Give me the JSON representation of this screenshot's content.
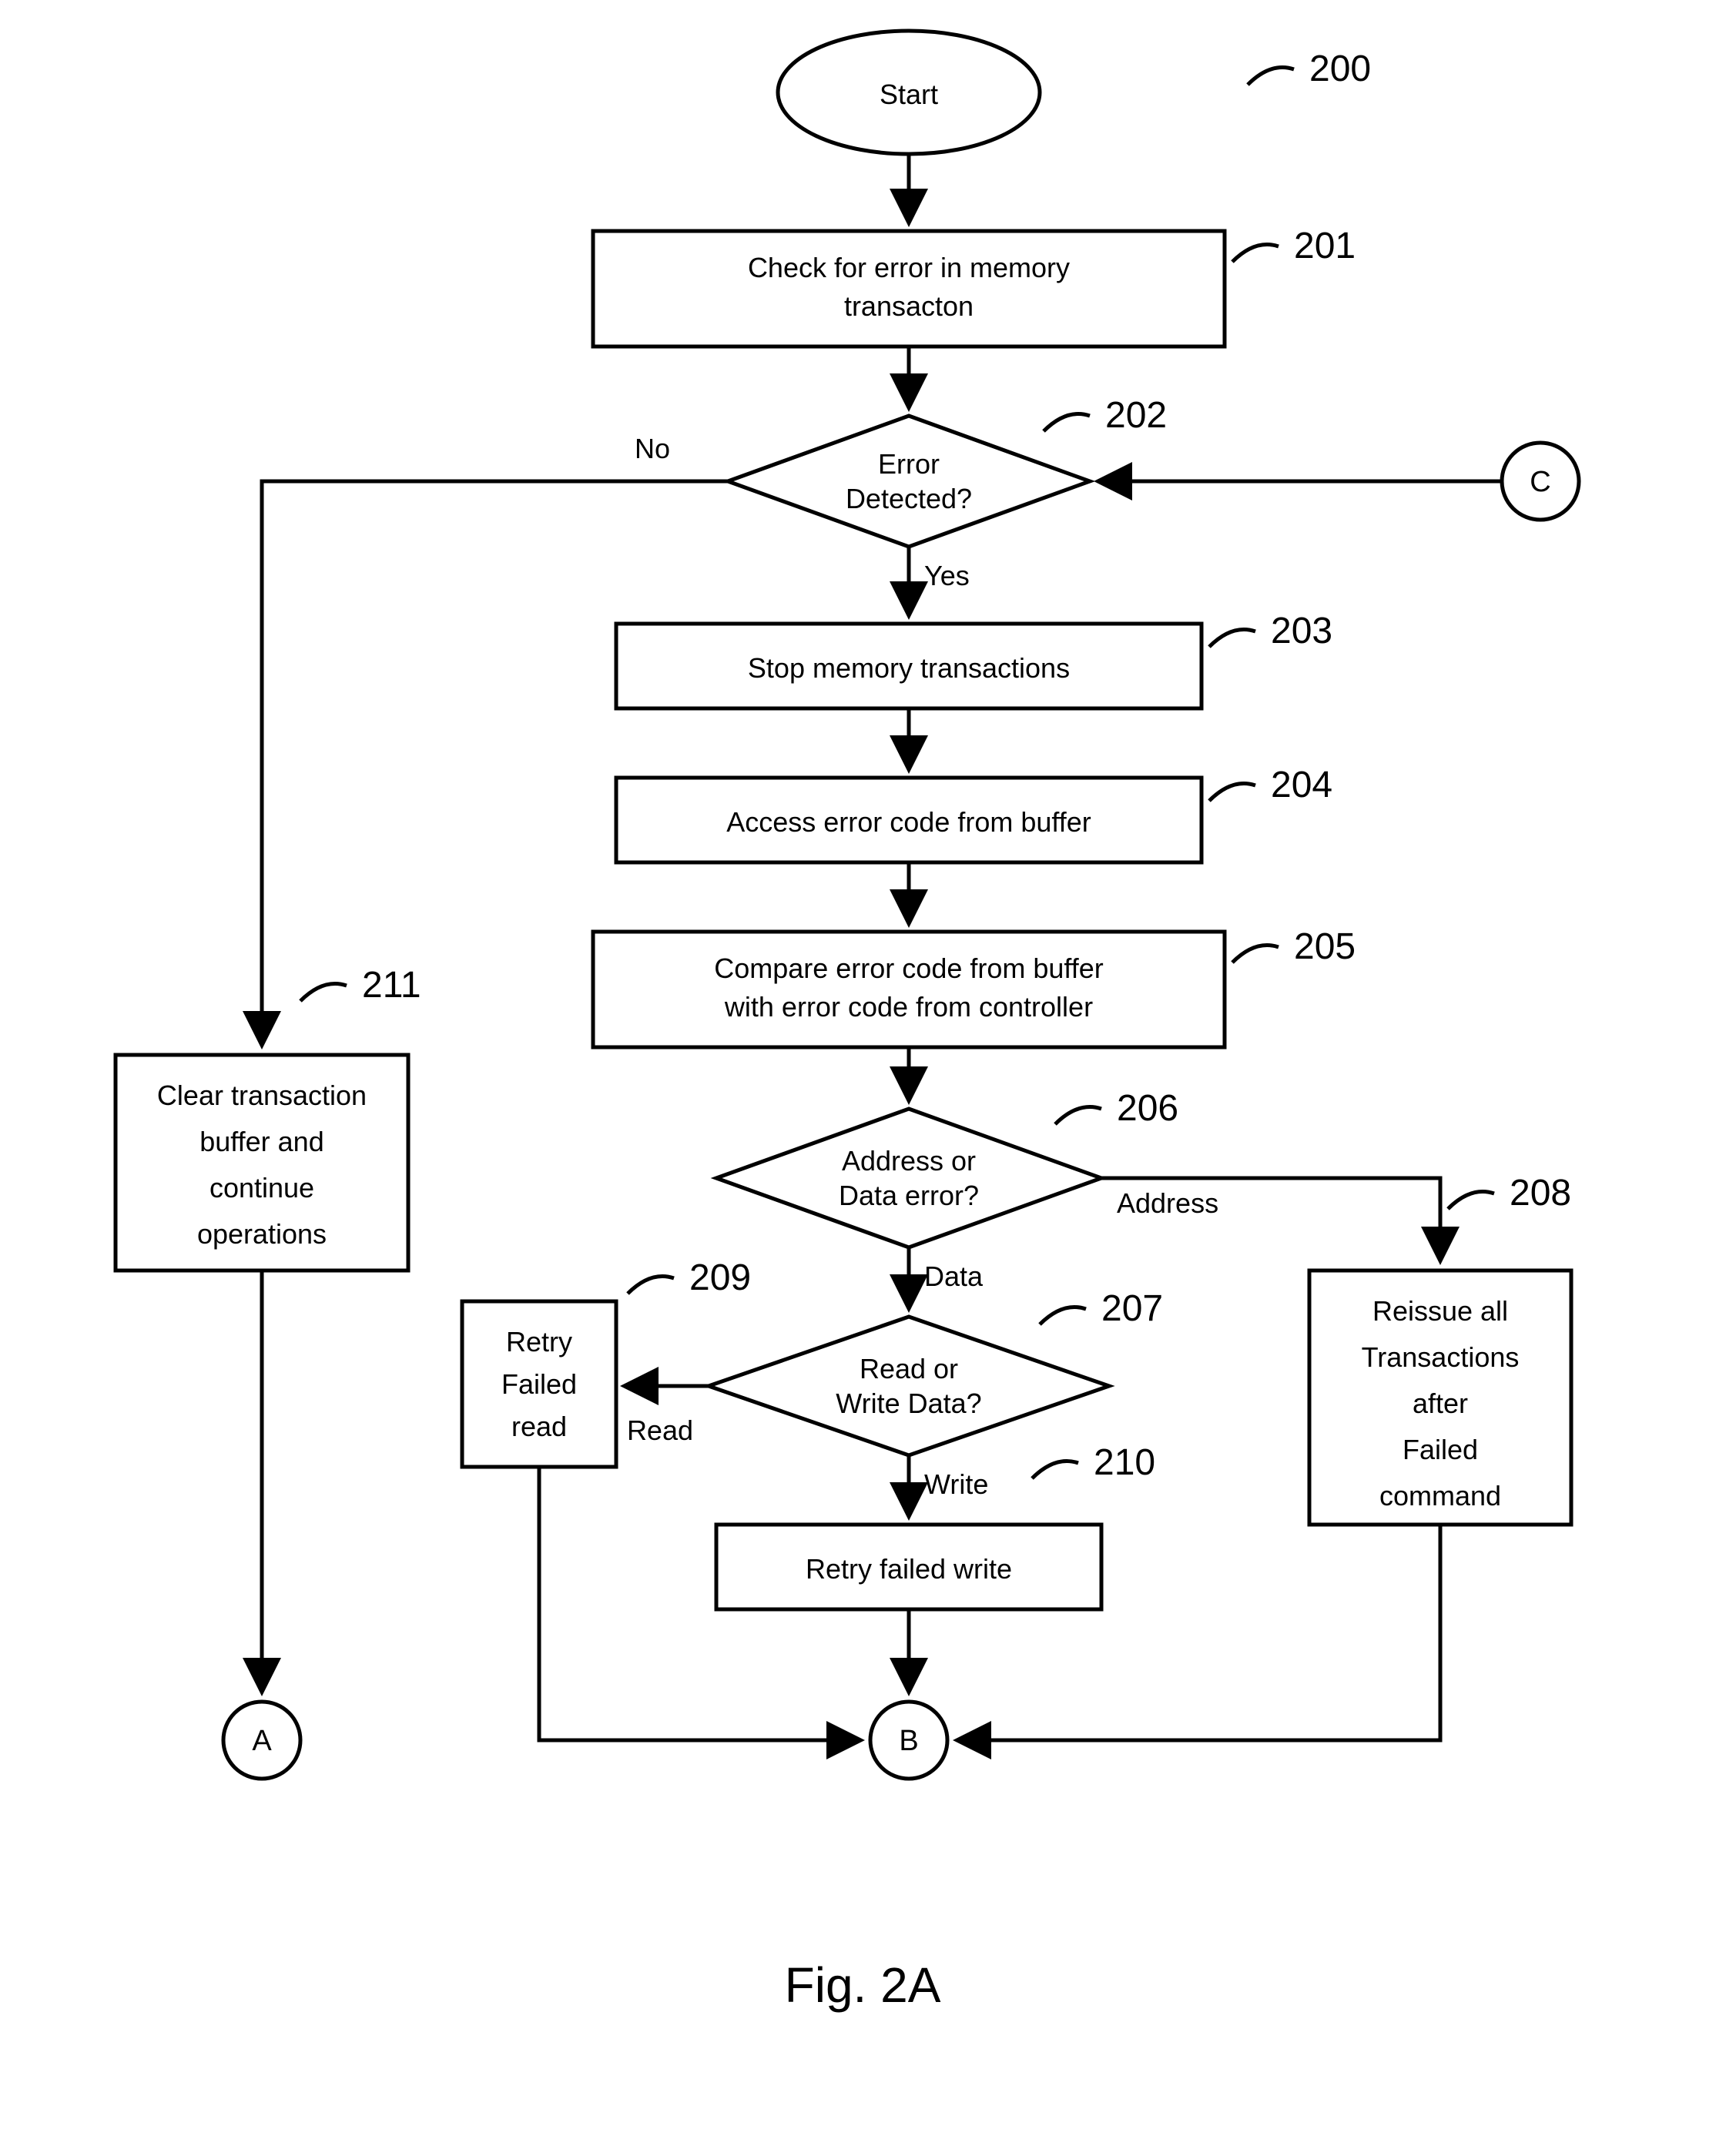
{
  "figure_label": "Fig. 2A",
  "refs": {
    "r200": "200",
    "r201": "201",
    "r202": "202",
    "r203": "203",
    "r204": "204",
    "r205": "205",
    "r206": "206",
    "r207": "207",
    "r208": "208",
    "r209": "209",
    "r210": "210",
    "r211": "211"
  },
  "nodes": {
    "start": "Start",
    "n201_l1": "Check for error in memory",
    "n201_l2": "transacton",
    "n202_l1": "Error",
    "n202_l2": "Detected?",
    "n203": "Stop memory transactions",
    "n204": "Access error code from buffer",
    "n205_l1": "Compare error code from buffer",
    "n205_l2": "with error code from controller",
    "n206_l1": "Address or",
    "n206_l2": "Data error?",
    "n207_l1": "Read or",
    "n207_l2": "Write Data?",
    "n208_l1": "Reissue all",
    "n208_l2": "Transactions",
    "n208_l3": "after",
    "n208_l4": "Failed",
    "n208_l5": "command",
    "n209_l1": "Retry",
    "n209_l2": "Failed",
    "n209_l3": "read",
    "n210": "Retry failed write",
    "n211_l1": "Clear transaction",
    "n211_l2": "buffer and",
    "n211_l3": "continue",
    "n211_l4": "operations"
  },
  "edges": {
    "no": "No",
    "yes": "Yes",
    "address": "Address",
    "data": "Data",
    "read": "Read",
    "write": "Write"
  },
  "connectors": {
    "a": "A",
    "b": "B",
    "c": "C"
  }
}
